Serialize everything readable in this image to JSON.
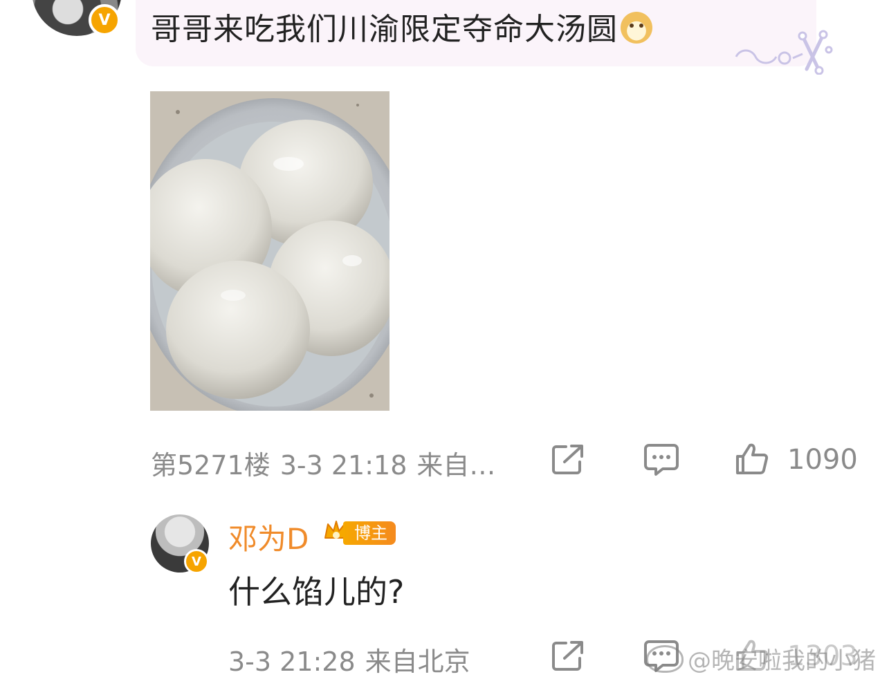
{
  "comment": {
    "text": "哥哥来吃我们川渝限定夺命大汤圆",
    "emoji_icon": "doge-icon",
    "floor": "第5271楼",
    "datetime": "3-3 21:18",
    "location": "来自…",
    "likes": "1090",
    "verified_badge": "V"
  },
  "reply": {
    "author": "邓为D",
    "role_badge": "博主",
    "text": "什么馅儿的?",
    "datetime": "3-3 21:28",
    "location": "来自北京",
    "likes": "1303",
    "verified_badge": "V"
  },
  "watermark": "@晚安啦我的小猪",
  "colors": {
    "author_name": "#f08b2a",
    "meta_text": "#8a8a8a",
    "bubble_bg": "#fbf4fa",
    "verified": "#f6a400"
  }
}
